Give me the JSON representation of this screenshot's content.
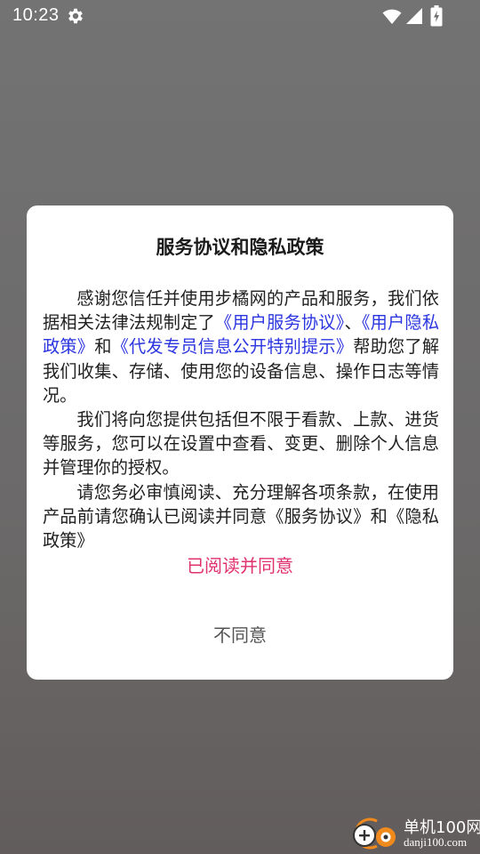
{
  "status_bar": {
    "time": "10:23",
    "icons": [
      "gear-icon",
      "wifi-icon",
      "signal-icon",
      "battery-charging-icon"
    ]
  },
  "dialog": {
    "title": "服务协议和隐私政策",
    "paragraph1": {
      "text_before": "感谢您信任并使用步橘网的产品和服务，我们依据相关法律法规制定了",
      "link_service": "《用户服务协议》",
      "sep1": "、",
      "link_privacy": "《用户隐私政策》",
      "sep2": "和",
      "link_special": "《代发专员信息公开特别提示》",
      "text_after": "帮助您了解我们收集、存储、使用您的设备信息、操作日志等情况。"
    },
    "paragraph2": "我们将向您提供包括但不限于看款、上款、进货等服务，您可以在设置中查看、变更、删除个人信息并管理你的授权。",
    "paragraph3": "请您务必审慎阅读、充分理解各项条款，在使用产品前请您确认已阅读并同意《服务协议》和《隐私政策》",
    "agree_label": "已阅读并同意",
    "disagree_label": "不同意"
  },
  "colors": {
    "link": "#2a35e0",
    "agree": "#e0316f",
    "disagree": "#555555",
    "watermark_orange": "#f08a1c"
  },
  "watermark": {
    "title": "单机100网",
    "url": "danji100.com"
  }
}
